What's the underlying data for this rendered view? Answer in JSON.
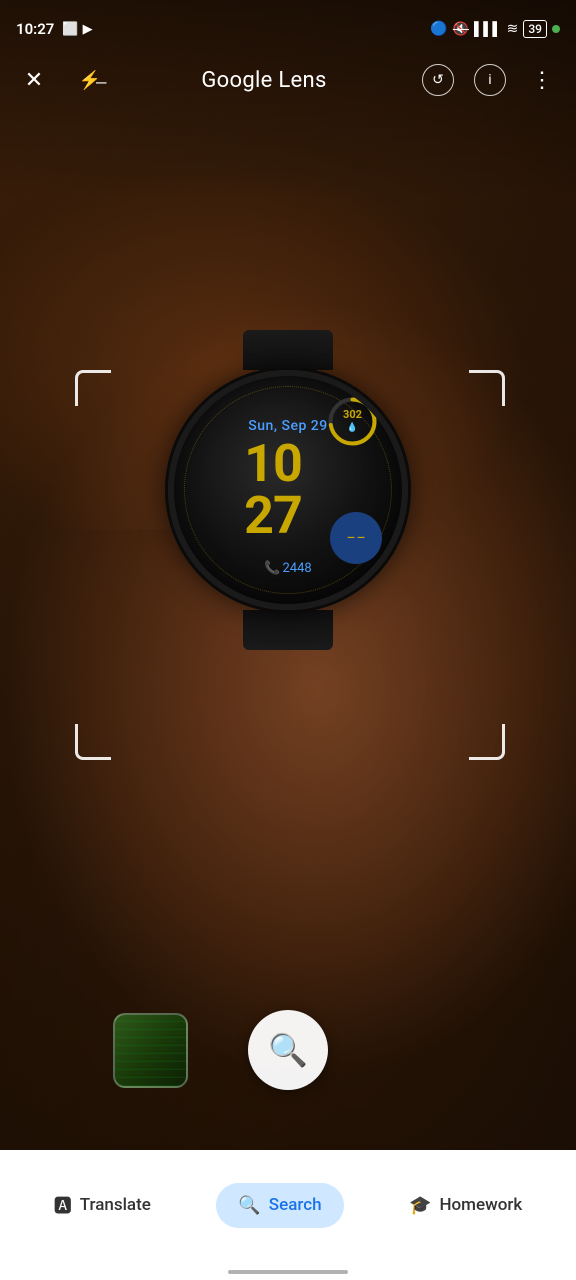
{
  "status_bar": {
    "time": "10:27",
    "battery_level": "39"
  },
  "toolbar": {
    "title": "Google Lens",
    "close_label": "✕",
    "flash_off_label": "flash off",
    "history_label": "history",
    "info_label": "ⓘ",
    "more_label": "⋮"
  },
  "watch": {
    "date": "Sun, Sep 29",
    "hour": "10",
    "minute": "27",
    "steps": "2448",
    "ring_value": "302"
  },
  "bottom_tabs": {
    "translate_label": "Translate",
    "search_label": "Search",
    "homework_label": "Homework"
  }
}
